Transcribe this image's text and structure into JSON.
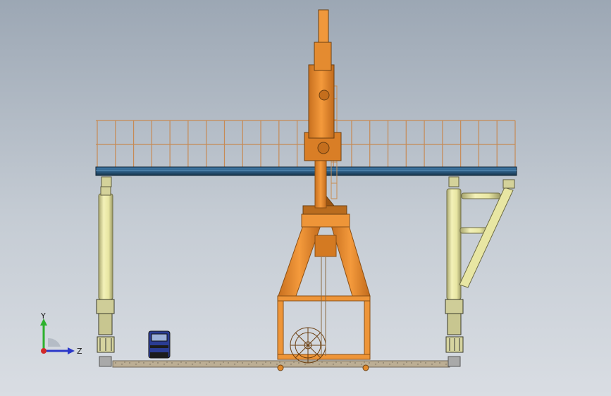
{
  "viewport": {
    "background_top": "#9ca7b4",
    "background_bottom": "#d9dde3"
  },
  "model": {
    "colors": {
      "crane_body": "#e9892e",
      "crane_shadow": "#b9651b",
      "beam_blue": "#2d5e86",
      "beam_dark": "#17344c",
      "railing": "#c68a55",
      "column_yellow": "#e8e6a3",
      "column_shadow": "#a9a770",
      "rail_concrete": "#b7ab93",
      "truck_blue": "#2a3c93"
    }
  },
  "triad": {
    "y_label": "Y",
    "z_label": "Z",
    "y_color": "#2db12d",
    "z_color": "#2b38c9",
    "x_color": "#d22a2a"
  }
}
